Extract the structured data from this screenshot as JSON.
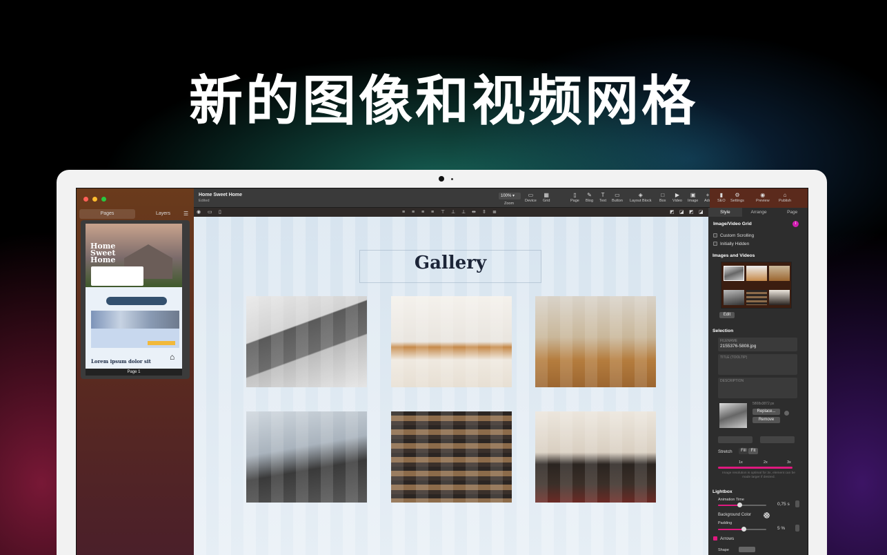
{
  "headline": "新的图像和视频网格",
  "app": {
    "document_title": "Home Sweet Home",
    "document_status": "Edited",
    "sidebar_tabs": [
      "Pages",
      "Layers"
    ],
    "page_label": "Page 1",
    "thumb_title": "Home Sweet Home",
    "thumb_lorem": "Lorem ipsum dolor sit"
  },
  "toolbar": {
    "zoom_value": "100%",
    "zoom_label": "Zoom",
    "device_label": "Device",
    "grid_label": "Grid",
    "page_label": "Page",
    "blog_label": "Blog",
    "text_label": "Text",
    "button_label": "Button",
    "layout_block_label": "Layout Block",
    "box_label": "Box",
    "video_label": "Video",
    "image_label": "Image",
    "add_label": "Add",
    "seo_label": "SEO",
    "settings_label": "Settings",
    "preview_label": "Preview",
    "publish_label": "Publish"
  },
  "canvas": {
    "gallery_title": "Gallery"
  },
  "inspector": {
    "tabs": [
      "Style",
      "Arrange",
      "Page"
    ],
    "section_title": "Image/Video Grid",
    "custom_scrolling": "Custom Scrolling",
    "initially_hidden": "Initially Hidden",
    "images_videos": "Images and Videos",
    "edit_button": "Edit",
    "selection": "Selection",
    "filename_label": "FILENAME",
    "filename_value": "2155376-5808.jpg",
    "title_label": "TITLE (TOOLTIP)",
    "description_label": "DESCRIPTION",
    "image_size": "5808x3872 px",
    "replace_button": "Replace...",
    "remove_button": "Remove",
    "stretch_label": "Stretch",
    "stretch_fill": "Fill",
    "stretch_fit": "Fit",
    "scale_marks": [
      "1x",
      "2x",
      "3x"
    ],
    "resolution_note": "Image resolution is optimal for 3x, element can be made larger if desired.",
    "lightbox": "Lightbox",
    "animation_time_label": "Animation Time",
    "animation_time_value": "0,75 s",
    "background_color_label": "Background Color",
    "padding_label": "Padding",
    "padding_value": "5 %",
    "arrows_label": "Arrows",
    "shape_label": "Shape"
  },
  "colors": {
    "accent": "#e0197f",
    "info": "#d01eb0",
    "title_text": "#1c2538"
  }
}
